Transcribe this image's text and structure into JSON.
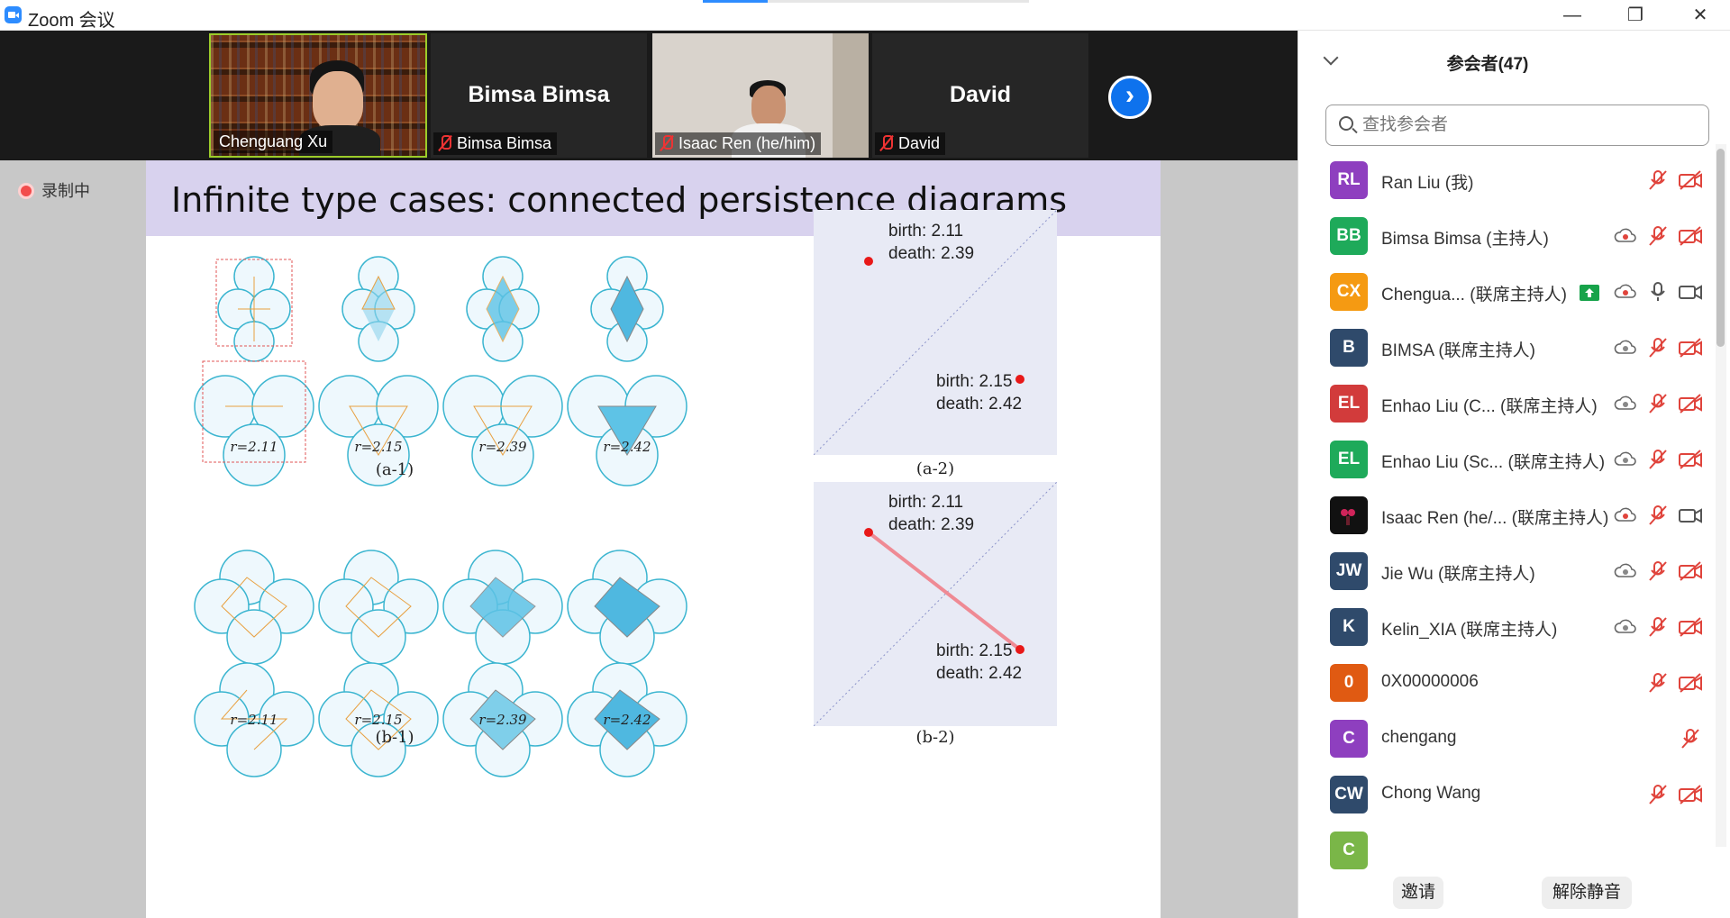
{
  "window": {
    "title": "Zoom 会议",
    "minimize": "—",
    "restore": "❐",
    "close": "✕"
  },
  "video_strip": {
    "tiles": [
      {
        "name_label": "Chenguang Xu",
        "big_name": ""
      },
      {
        "name_label": "Bimsa Bimsa",
        "big_name": "Bimsa Bimsa"
      },
      {
        "name_label": "Isaac Ren (he/him)",
        "big_name": ""
      },
      {
        "name_label": "David",
        "big_name": "David"
      }
    ],
    "next_icon": "›"
  },
  "recording": {
    "label": "录制中"
  },
  "slide": {
    "title": "Infinite type cases: connected persistence diagrams",
    "radii_top": [
      "r=2.11",
      "r=2.15",
      "r=2.39",
      "r=2.42"
    ],
    "radii_bottom": [
      "r=2.11",
      "r=2.15",
      "r=2.39",
      "r=2.42"
    ],
    "captions": {
      "a1": "(a-1)",
      "a2": "(a-2)",
      "b1": "(b-1)",
      "b2": "(b-2)"
    },
    "pd_a": {
      "p1": "birth: 2.11\ndeath: 2.39",
      "p2": "birth: 2.15\ndeath: 2.42"
    },
    "pd_b": {
      "p1": "birth: 2.11\ndeath: 2.39",
      "p2": "birth: 2.15\ndeath: 2.42"
    }
  },
  "sidebar": {
    "title": "参会者(47)",
    "search_placeholder": "查找参会者",
    "participants": [
      {
        "initials": "RL",
        "color": "#8e3fbf",
        "name": "Ran Liu (我)"
      },
      {
        "initials": "BB",
        "color": "#1eaa5a",
        "name": "Bimsa Bimsa (主持人)"
      },
      {
        "initials": "CX",
        "color": "#f59a12",
        "name": "Chengua... (联席主持人)"
      },
      {
        "initials": "B",
        "color": "#2f4a6b",
        "name": "BIMSA (联席主持人)"
      },
      {
        "initials": "EL",
        "color": "#d23b3b",
        "name": "Enhao Liu  (C...  (联席主持人)"
      },
      {
        "initials": "EL",
        "color": "#1eaa5a",
        "name": "Enhao Liu (Sc...  (联席主持人)"
      },
      {
        "initials": "",
        "color": "#111111",
        "name": "Isaac Ren (he/...  (联席主持人)"
      },
      {
        "initials": "JW",
        "color": "#2f4a6b",
        "name": "Jie Wu (联席主持人)"
      },
      {
        "initials": "K",
        "color": "#2f4a6b",
        "name": "Kelin_XIA (联席主持人)"
      },
      {
        "initials": "0",
        "color": "#e05a12",
        "name": "0X00000006"
      },
      {
        "initials": "C",
        "color": "#8e3fbf",
        "name": "chengang"
      },
      {
        "initials": "CW",
        "color": "#2f4a6b",
        "name": "Chong Wang"
      },
      {
        "initials": "C",
        "color": "#7ab648",
        "name": ""
      }
    ],
    "invite_label": "邀请",
    "unmute_label": "解除静音"
  }
}
